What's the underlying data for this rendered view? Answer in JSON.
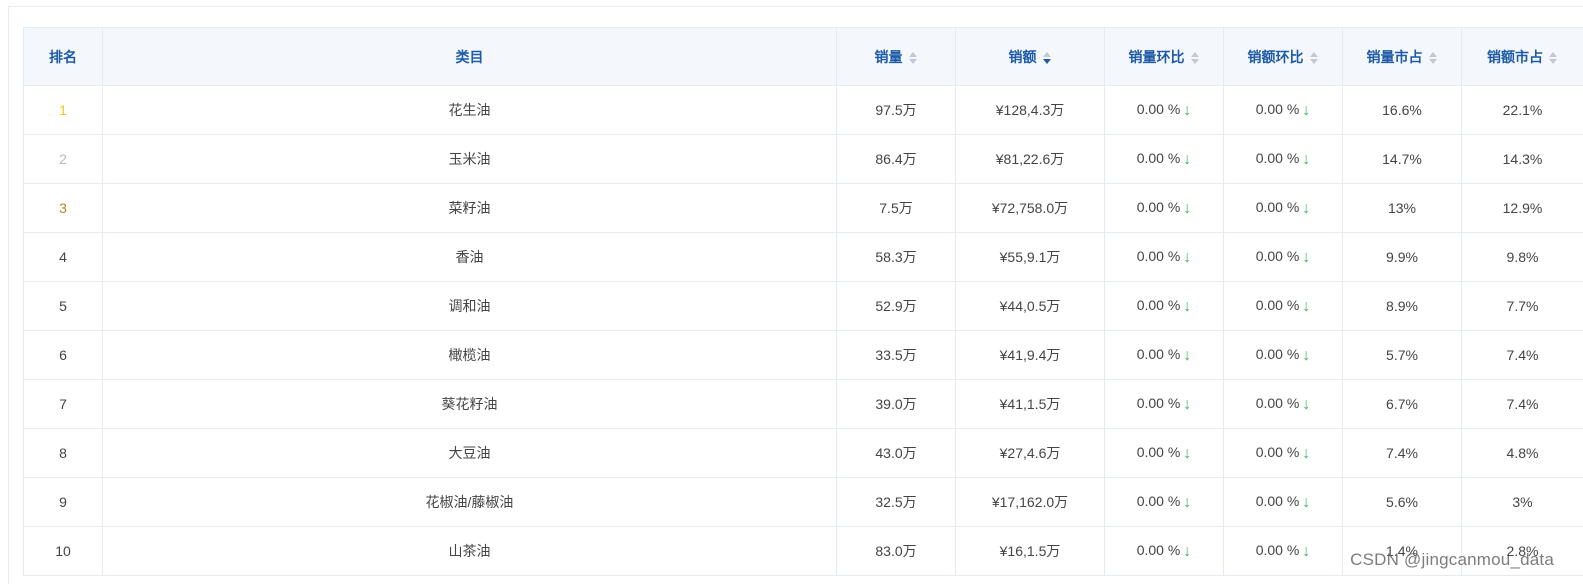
{
  "table": {
    "headers": {
      "rank": "排名",
      "category": "类目",
      "sales_volume": "销量",
      "sales_amount": "销额",
      "volume_mom": "销量环比",
      "amount_mom": "销额环比",
      "volume_share": "销量市占",
      "amount_share": "销额市占"
    },
    "rows": [
      {
        "rank": "1",
        "category": "花生油",
        "volume": "97.5万",
        "amount": "¥128,4.3万",
        "volume_mom": "0.00 %",
        "amount_mom": "0.00 %",
        "volume_share": "16.6%",
        "amount_share": "22.1%"
      },
      {
        "rank": "2",
        "category": "玉米油",
        "volume": "86.4万",
        "amount": "¥81,22.6万",
        "volume_mom": "0.00 %",
        "amount_mom": "0.00 %",
        "volume_share": "14.7%",
        "amount_share": "14.3%"
      },
      {
        "rank": "3",
        "category": "菜籽油",
        "volume": "7.5万",
        "amount": "¥72,758.0万",
        "volume_mom": "0.00 %",
        "amount_mom": "0.00 %",
        "volume_share": "13%",
        "amount_share": "12.9%"
      },
      {
        "rank": "4",
        "category": "香油",
        "volume": "58.3万",
        "amount": "¥55,9.1万",
        "volume_mom": "0.00 %",
        "amount_mom": "0.00 %",
        "volume_share": "9.9%",
        "amount_share": "9.8%"
      },
      {
        "rank": "5",
        "category": "调和油",
        "volume": "52.9万",
        "amount": "¥44,0.5万",
        "volume_mom": "0.00 %",
        "amount_mom": "0.00 %",
        "volume_share": "8.9%",
        "amount_share": "7.7%"
      },
      {
        "rank": "6",
        "category": "橄榄油",
        "volume": "33.5万",
        "amount": "¥41,9.4万",
        "volume_mom": "0.00 %",
        "amount_mom": "0.00 %",
        "volume_share": "5.7%",
        "amount_share": "7.4%"
      },
      {
        "rank": "7",
        "category": "葵花籽油",
        "volume": "39.0万",
        "amount": "¥41,1.5万",
        "volume_mom": "0.00 %",
        "amount_mom": "0.00 %",
        "volume_share": "6.7%",
        "amount_share": "7.4%"
      },
      {
        "rank": "8",
        "category": "大豆油",
        "volume": "43.0万",
        "amount": "¥27,4.6万",
        "volume_mom": "0.00 %",
        "amount_mom": "0.00 %",
        "volume_share": "7.4%",
        "amount_share": "4.8%"
      },
      {
        "rank": "9",
        "category": "花椒油/藤椒油",
        "volume": "32.5万",
        "amount": "¥17,162.0万",
        "volume_mom": "0.00 %",
        "amount_mom": "0.00 %",
        "volume_share": "5.6%",
        "amount_share": "3%"
      },
      {
        "rank": "10",
        "category": "山茶油",
        "volume": "83.0万",
        "amount": "¥16,1.5万",
        "volume_mom": "0.00 %",
        "amount_mom": "0.00 %",
        "volume_share": "1.4%",
        "amount_share": "2.8%"
      }
    ]
  },
  "colors": {
    "header_text": "#1d5aa8",
    "header_bg": "#f4f8fd",
    "arrow_down": "#3cb95a",
    "rank1": "#f5c518",
    "rank2": "#b8b8b8",
    "rank3": "#b8862b"
  },
  "icons": {
    "sort": "sort-caret-icon",
    "mom_trend": "arrow-down-icon"
  },
  "watermark": "CSDN @jingcanmou_data"
}
